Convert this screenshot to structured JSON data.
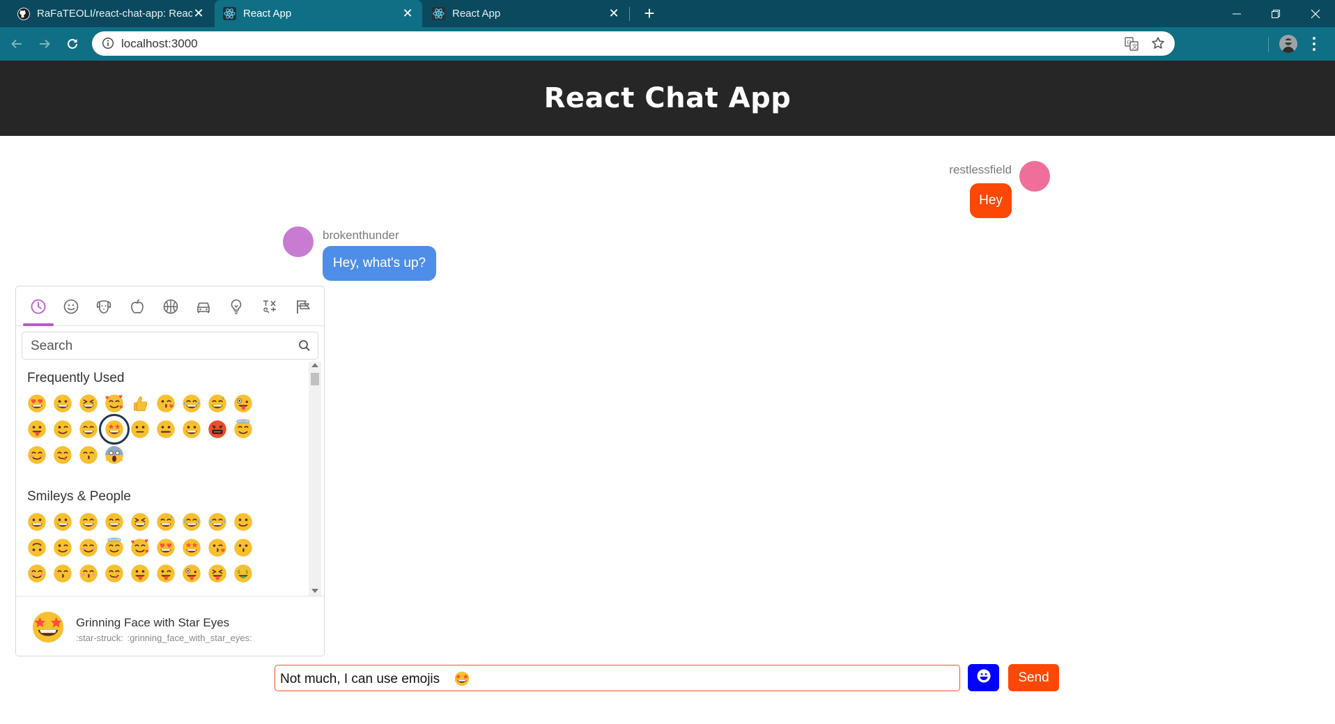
{
  "browser": {
    "tabs": [
      {
        "title": "RaFaTEOLI/react-chat-app: React",
        "favicon": "github-icon",
        "active": false
      },
      {
        "title": "React App",
        "favicon": "react-icon",
        "active": true
      },
      {
        "title": "React App",
        "favicon": "react-icon",
        "active": false
      }
    ],
    "url": "localhost:3000"
  },
  "app": {
    "title": "React Chat App",
    "messages": [
      {
        "user": "restlessfield",
        "text": "Hey",
        "side": "right",
        "avatar_color": "#f06f9a",
        "bubble_color": "#fc4805"
      },
      {
        "user": "brokenthunder",
        "text": "Hey, what's up?",
        "side": "left",
        "avatar_color": "#c77bd1",
        "bubble_color": "#4e8ee8"
      }
    ],
    "composer": {
      "value": "Not much, I can use emojis",
      "value_emoji": "star-struck",
      "send_label": "Send",
      "emoji_button_icon": "smiley-icon"
    }
  },
  "picker": {
    "categories": [
      "clock-icon",
      "smiley-icon",
      "dog-icon",
      "apple-icon",
      "basketball-icon",
      "car-icon",
      "lightbulb-icon",
      "symbols-icon",
      "flags-icon"
    ],
    "search_placeholder": "Search",
    "sections": [
      {
        "title": "Frequently Used",
        "emojis": [
          "heart-eyes",
          "grinning",
          "laughing",
          "smiling-hearts",
          "thumbs-up",
          "kissing-heart",
          "joy",
          "sweat-smile",
          "zany",
          "tongue",
          "wink",
          "grin",
          "star-struck",
          "neutral",
          "zipper",
          "grinning",
          "cursing",
          "innocent",
          "blush",
          "yum",
          "kissing-closed",
          "scream"
        ]
      },
      {
        "title": "Smileys & People",
        "emojis": [
          "grinning",
          "smiley",
          "smile",
          "grin",
          "laughing",
          "sweat-smile",
          "rofl",
          "joy",
          "slightly-smiling",
          "upside-down",
          "wink",
          "blush",
          "innocent",
          "smiling-hearts",
          "heart-eyes",
          "star-struck",
          "kissing-heart",
          "kissing",
          "relaxed",
          "kissing-closed",
          "kissing-smiling",
          "yum",
          "tongue",
          "winking-tongue",
          "zany",
          "squinting-tongue",
          "money-mouth"
        ]
      }
    ],
    "selected": "star-struck",
    "preview": {
      "name": "Grinning Face with Star Eyes",
      "shortcodes": ":star-struck:  :grinning_face_with_star_eyes:"
    }
  }
}
